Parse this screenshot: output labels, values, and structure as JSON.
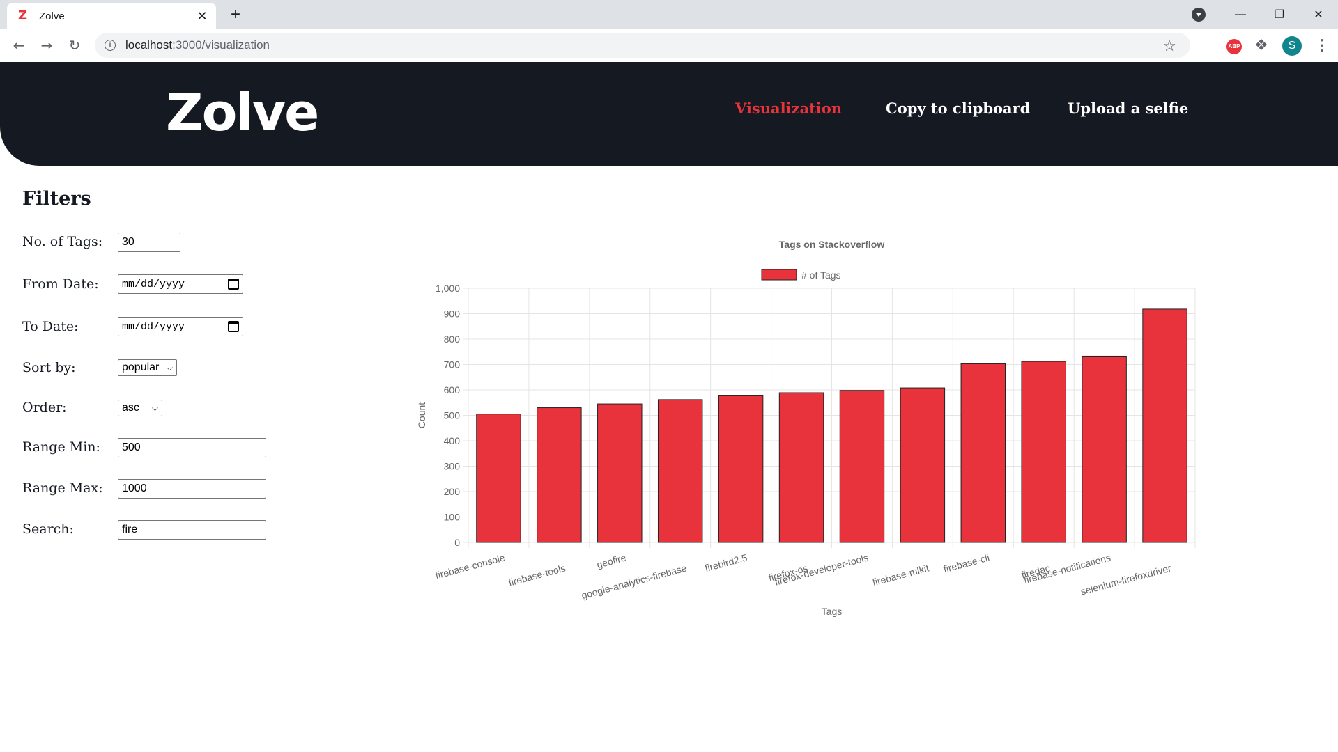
{
  "browser": {
    "tab_title": "Zolve",
    "tab_favicon": "Z",
    "tab_close": "✕",
    "new_tab": "+",
    "url_host": "localhost",
    "url_path": ":3000/visualization",
    "avatar_letter": "S",
    "abp_label": "ABP"
  },
  "header": {
    "logo": "Zolve",
    "nav": [
      {
        "label": "Visualization",
        "active": true
      },
      {
        "label": "Copy to clipboard",
        "active": false
      },
      {
        "label": "Upload a selfie",
        "active": false
      }
    ]
  },
  "filters": {
    "title": "Filters",
    "no_of_tags": {
      "label": "No. of Tags:",
      "value": "30"
    },
    "from_date": {
      "label": "From Date:",
      "value": "mm/dd/yyyy"
    },
    "to_date": {
      "label": "To Date:",
      "value": "mm/dd/yyyy"
    },
    "sort_by": {
      "label": "Sort by:",
      "value": "popular"
    },
    "order": {
      "label": "Order:",
      "value": "asc"
    },
    "range_min": {
      "label": "Range Min:",
      "value": "500"
    },
    "range_max": {
      "label": "Range Max:",
      "value": "1000"
    },
    "search": {
      "label": "Search:",
      "value": "fire"
    }
  },
  "colors": {
    "accent": "#e8333c",
    "header_bg": "#151922"
  },
  "chart_data": {
    "type": "bar",
    "title": "Tags on Stackoverflow",
    "xlabel": "Tags",
    "ylabel": "Count",
    "ylim": [
      0,
      1000
    ],
    "yticks": [
      "0",
      "100",
      "200",
      "300",
      "400",
      "500",
      "600",
      "700",
      "800",
      "900",
      "1,000"
    ],
    "grid": true,
    "legend_position": "top",
    "series": [
      {
        "name": "# of Tags",
        "color": "#e8333c"
      }
    ],
    "categories": [
      "firebase-console",
      "firebase-tools",
      "geofire",
      "google-analytics-firebase",
      "firebird2.5",
      "firefox-os",
      "firefox-developer-tools",
      "firebase-mlkit",
      "firebase-cli",
      "firedac",
      "firebase-notifications",
      "selenium-firefoxdriver"
    ],
    "values": [
      505,
      530,
      545,
      562,
      577,
      589,
      598,
      608,
      703,
      712,
      733,
      918
    ]
  }
}
